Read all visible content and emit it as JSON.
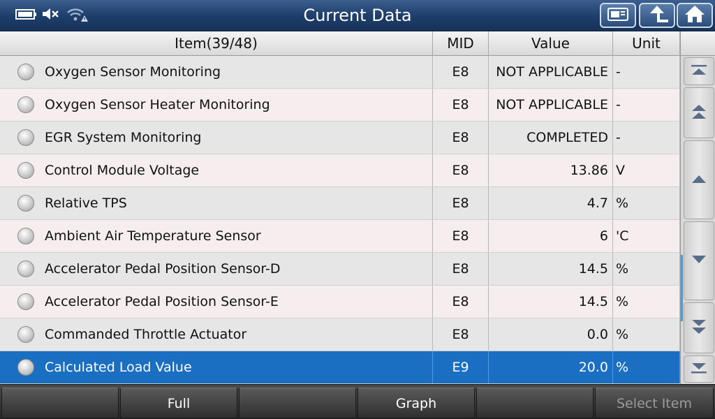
{
  "header": {
    "title": "Current Data",
    "status_icons": [
      "battery-icon",
      "mute-icon",
      "wifi-warning-icon"
    ],
    "buttons": [
      "print-screen-icon",
      "back-icon",
      "home-icon"
    ]
  },
  "table": {
    "columns": {
      "item": "Item(39/48)",
      "mid": "MID",
      "value": "Value",
      "unit": "Unit"
    },
    "rows": [
      {
        "item": "Oxygen Sensor Monitoring",
        "mid": "E8",
        "value": "NOT APPLICABLE",
        "unit": "-"
      },
      {
        "item": "Oxygen Sensor Heater Monitoring",
        "mid": "E8",
        "value": "NOT APPLICABLE",
        "unit": "-"
      },
      {
        "item": "EGR System Monitoring",
        "mid": "E8",
        "value": "COMPLETED",
        "unit": "-"
      },
      {
        "item": "Control Module Voltage",
        "mid": "E8",
        "value": "13.86",
        "unit": "V"
      },
      {
        "item": "Relative TPS",
        "mid": "E8",
        "value": "4.7",
        "unit": "%"
      },
      {
        "item": "Ambient Air Temperature Sensor",
        "mid": "E8",
        "value": "6",
        "unit": "'C"
      },
      {
        "item": "Accelerator Pedal Position Sensor-D",
        "mid": "E8",
        "value": "14.5",
        "unit": "%"
      },
      {
        "item": "Accelerator Pedal Position Sensor-E",
        "mid": "E8",
        "value": "14.5",
        "unit": "%"
      },
      {
        "item": "Commanded Throttle Actuator",
        "mid": "E8",
        "value": "0.0",
        "unit": "%"
      },
      {
        "item": "Calculated Load Value",
        "mid": "E9",
        "value": "20.0",
        "unit": "%"
      }
    ],
    "selected_index": 9
  },
  "bottom_bar": {
    "buttons": [
      "",
      "Full",
      "",
      "Graph",
      "",
      "Select Item"
    ]
  },
  "colors": {
    "selected_row": "#1a6fc3",
    "title_bar": "#1f3f6c",
    "scroll_indicator": "#2aa4ff"
  }
}
